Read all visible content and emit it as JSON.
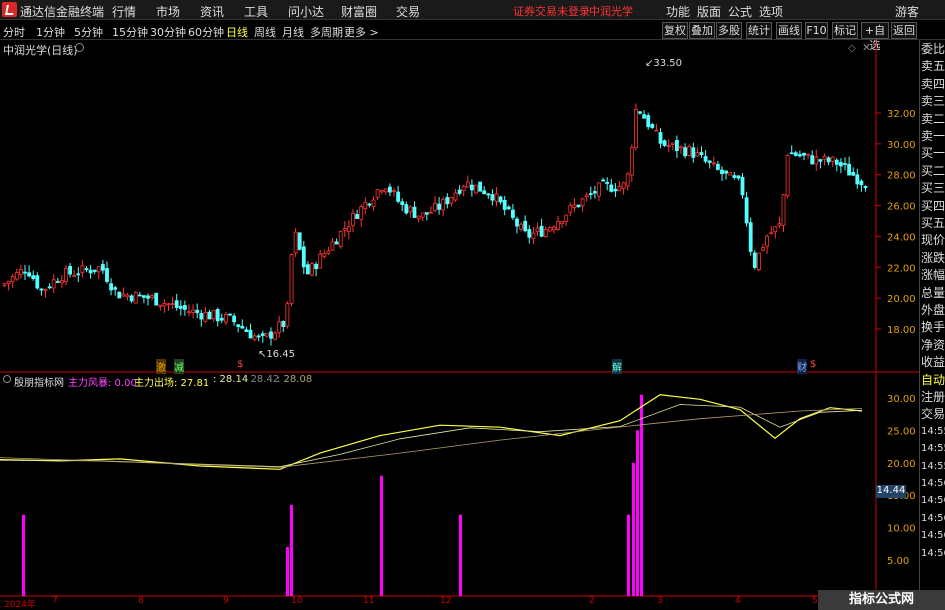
{
  "menubar": {
    "app_name": "通达信金融终端",
    "items": [
      "行情",
      "市场",
      "资讯",
      "工具",
      "问小达",
      "财富圈",
      "交易"
    ],
    "alert_text": "证券交易未登录",
    "stock_name": "中润光学",
    "right_items": [
      "功能",
      "版面",
      "公式",
      "选项"
    ],
    "guest": "游客"
  },
  "periods": [
    "分时",
    "1分钟",
    "5分钟",
    "15分钟",
    "30分钟",
    "60分钟",
    "日线",
    "周线",
    "月线",
    "多周期",
    "更多 >"
  ],
  "active_period": "日线",
  "toolbar": [
    "复权",
    "叠加",
    "多股",
    "统计",
    "画线",
    "F10",
    "标记",
    "+自选",
    "返回"
  ],
  "chart": {
    "title": "中润光学(日线)",
    "high_label": "33.50",
    "low_label": "16.45",
    "y_ticks": [
      "32.00",
      "30.00",
      "28.00",
      "26.00",
      "24.00",
      "22.00",
      "20.00",
      "18.00"
    ],
    "markers": [
      "激",
      "减",
      "解",
      "财"
    ]
  },
  "indicator": {
    "name": "殷朋指标网",
    "risk_label": "主力风暴: 0.00",
    "exit_label": "主力出场: 27.81",
    "v2": ": 28.14",
    "v3": ": 28.42",
    "v4": ": 28.08",
    "y_ticks": [
      "30.00",
      "25.00",
      "20.00",
      "15.00",
      "10.00",
      "5.00"
    ],
    "current_value": "14.44"
  },
  "right_panel": [
    "委比",
    "卖五",
    "卖四",
    "卖三",
    "卖二",
    "卖一",
    "买一",
    "买二",
    "买三",
    "买四",
    "买五",
    "现价",
    "涨跌",
    "涨幅",
    "总量",
    "外盘",
    "换手",
    "净资",
    "收益",
    "自动",
    "注册",
    "交易",
    "14:55",
    "14:55",
    "14:55",
    "14:56",
    "14:56",
    "14:56",
    "14:56",
    "14:56"
  ],
  "dates": [
    "2024年",
    "7",
    "8",
    "9",
    "10",
    "11",
    "12",
    "2",
    "3",
    "4",
    "5"
  ],
  "watermark": "指标公式网",
  "watermark_url": "www.zbgs3.com",
  "colors": {
    "up": "#ff3333",
    "down": "#54ffff",
    "yellow": "#ffff44",
    "magenta": "#ff00ff"
  }
}
